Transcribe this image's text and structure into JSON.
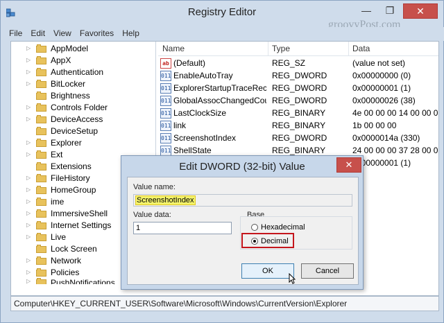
{
  "window": {
    "title": "Registry Editor",
    "minimize": "—",
    "maximize": "❐",
    "close": "✕",
    "watermark": "groovyPost.com"
  },
  "menu": [
    "File",
    "Edit",
    "View",
    "Favorites",
    "Help"
  ],
  "tree": {
    "items": [
      {
        "label": "AppModel"
      },
      {
        "label": "AppX"
      },
      {
        "label": "Authentication"
      },
      {
        "label": "BitLocker"
      },
      {
        "label": "Brightness"
      },
      {
        "label": "Controls Folder"
      },
      {
        "label": "DeviceAccess"
      },
      {
        "label": "DeviceSetup"
      },
      {
        "label": "Explorer"
      },
      {
        "label": "Ext"
      },
      {
        "label": "Extensions"
      },
      {
        "label": "FileHistory"
      },
      {
        "label": "HomeGroup"
      },
      {
        "label": "ime"
      },
      {
        "label": "ImmersiveShell"
      },
      {
        "label": "Internet Settings"
      },
      {
        "label": "Live"
      },
      {
        "label": "Lock Screen"
      },
      {
        "label": "Network"
      },
      {
        "label": "Policies"
      },
      {
        "label": "PushNotifications"
      }
    ]
  },
  "list": {
    "headers": {
      "name": "Name",
      "type": "Type",
      "data": "Data"
    },
    "rows": [
      {
        "icon": "ab",
        "name": "(Default)",
        "type": "REG_SZ",
        "data": "(value not set)"
      },
      {
        "icon": "bin",
        "name": "EnableAutoTray",
        "type": "REG_DWORD",
        "data": "0x00000000 (0)"
      },
      {
        "icon": "bin",
        "name": "ExplorerStartupTraceRec...",
        "type": "REG_DWORD",
        "data": "0x00000001 (1)"
      },
      {
        "icon": "bin",
        "name": "GlobalAssocChangedCou...",
        "type": "REG_DWORD",
        "data": "0x00000026 (38)"
      },
      {
        "icon": "bin",
        "name": "LastClockSize",
        "type": "REG_BINARY",
        "data": "4e 00 00 00 14 00 00 0"
      },
      {
        "icon": "bin",
        "name": "link",
        "type": "REG_BINARY",
        "data": "1b 00 00 00"
      },
      {
        "icon": "bin",
        "name": "ScreenshotIndex",
        "type": "REG_DWORD",
        "data": "0x0000014a (330)"
      },
      {
        "icon": "bin",
        "name": "ShellState",
        "type": "REG_BINARY",
        "data": "24 00 00 00 37 28 00 0"
      },
      {
        "icon": "bin",
        "name": "",
        "type": "",
        "data": "0x00000001 (1)"
      }
    ]
  },
  "status": "Computer\\HKEY_CURRENT_USER\\Software\\Microsoft\\Windows\\CurrentVersion\\Explorer",
  "dialog": {
    "title": "Edit DWORD (32-bit) Value",
    "close": "✕",
    "value_name_label": "Value name:",
    "value_name": "ScreenshotIndex",
    "value_data_label": "Value data:",
    "value_data": "1",
    "base_label": "Base",
    "hex_label": "Hexadecimal",
    "dec_label": "Decimal",
    "ok": "OK",
    "cancel": "Cancel"
  },
  "colors": {
    "highlight_box": "#c4151c",
    "name_highlight": "#f4f36b"
  }
}
